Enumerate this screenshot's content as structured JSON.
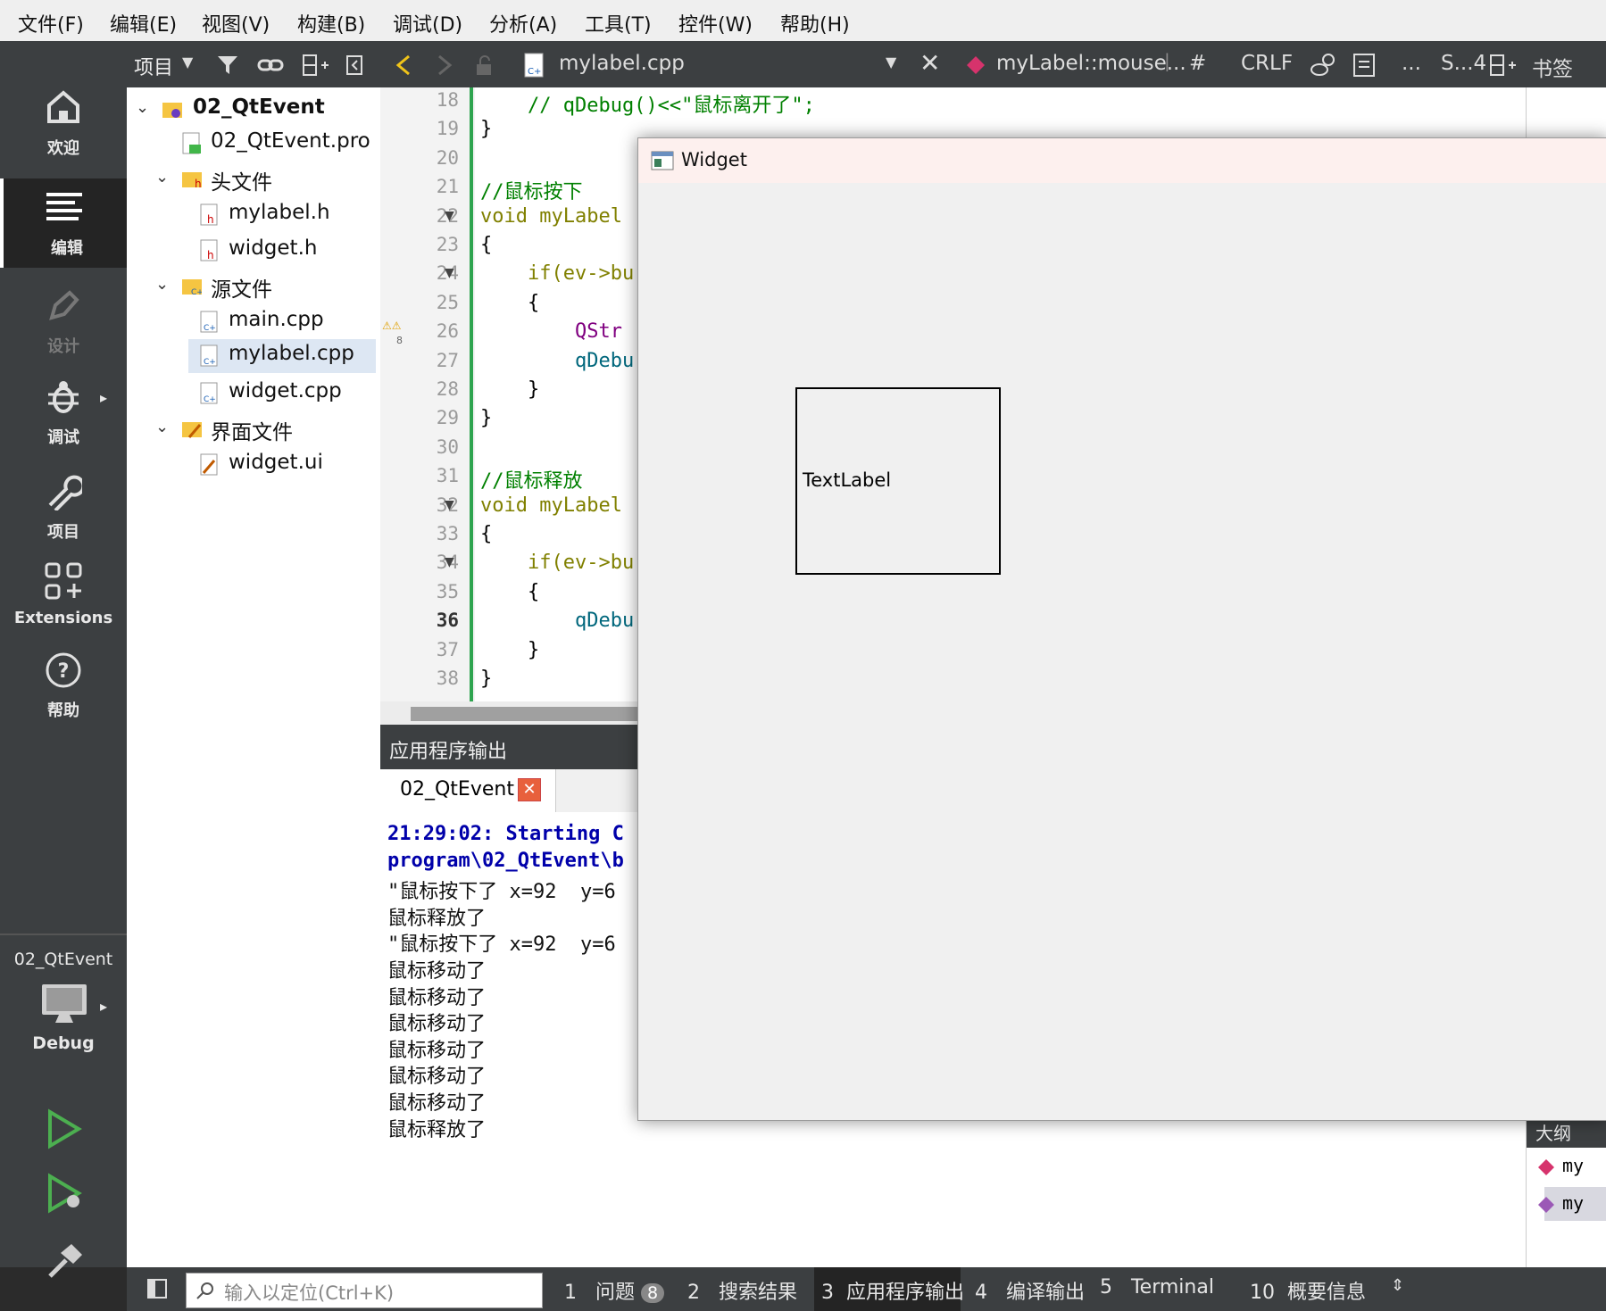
{
  "menu": [
    "文件(F)",
    "编辑(E)",
    "视图(V)",
    "构建(B)",
    "调试(D)",
    "分析(A)",
    "工具(T)",
    "控件(W)",
    "帮助(H)"
  ],
  "modes": [
    {
      "label": "欢迎",
      "icon": "home-icon"
    },
    {
      "label": "编辑",
      "icon": "edit-lines-icon"
    },
    {
      "label": "设计",
      "icon": "pen-icon"
    },
    {
      "label": "调试",
      "icon": "bug-icon"
    },
    {
      "label": "项目",
      "icon": "wrench-icon"
    },
    {
      "label": "Extensions",
      "icon": "extensions-icon"
    },
    {
      "label": "帮助",
      "icon": "help-icon"
    }
  ],
  "kit": {
    "project": "02_QtEvent",
    "config": "Debug"
  },
  "project_toolbar": {
    "label": "项目"
  },
  "tree": [
    {
      "label": "02_QtEvent",
      "level": 0,
      "bold": true,
      "expanded": true,
      "icon": "project-folder-icon"
    },
    {
      "label": "02_QtEvent.pro",
      "level": 1,
      "icon": "pro-file-icon"
    },
    {
      "label": "头文件",
      "level": 1,
      "expanded": true,
      "icon": "header-folder-icon"
    },
    {
      "label": "mylabel.h",
      "level": 2,
      "icon": "header-file-icon"
    },
    {
      "label": "widget.h",
      "level": 2,
      "icon": "header-file-icon"
    },
    {
      "label": "源文件",
      "level": 1,
      "expanded": true,
      "icon": "source-folder-icon"
    },
    {
      "label": "main.cpp",
      "level": 2,
      "icon": "cpp-file-icon"
    },
    {
      "label": "mylabel.cpp",
      "level": 2,
      "icon": "cpp-file-icon",
      "selected": true
    },
    {
      "label": "widget.cpp",
      "level": 2,
      "icon": "cpp-file-icon"
    },
    {
      "label": "界面文件",
      "level": 1,
      "expanded": true,
      "icon": "forms-folder-icon"
    },
    {
      "label": "widget.ui",
      "level": 2,
      "icon": "ui-file-icon"
    }
  ],
  "editor_toolbar": {
    "file": "mylabel.cpp",
    "symbol": "myLabel::mouse...",
    "hash": "#",
    "eol": "CRLF",
    "ellipsis": "...",
    "split": "S...4",
    "bookmarks": "书签"
  },
  "code_lines": [
    {
      "n": "18",
      "text": "    // qDebug()<<\"鼠标离开了\";",
      "kind": "comment"
    },
    {
      "n": "19",
      "text": "}"
    },
    {
      "n": "20",
      "text": ""
    },
    {
      "n": "21",
      "text": "//鼠标按下",
      "kind": "comment"
    },
    {
      "n": "22",
      "text": "void myLabel",
      "kind": "decl",
      "fold": true
    },
    {
      "n": "23",
      "text": "{"
    },
    {
      "n": "24",
      "text": "    if(ev->bu",
      "kind": "if",
      "fold": true
    },
    {
      "n": "25",
      "text": "    {"
    },
    {
      "n": "26",
      "text": "        QStr",
      "kind": "type",
      "warn": "8"
    },
    {
      "n": "27",
      "text": "        qDebu",
      "kind": "fn"
    },
    {
      "n": "28",
      "text": "    }"
    },
    {
      "n": "29",
      "text": "}"
    },
    {
      "n": "30",
      "text": ""
    },
    {
      "n": "31",
      "text": "//鼠标释放",
      "kind": "comment"
    },
    {
      "n": "32",
      "text": "void myLabel",
      "kind": "decl",
      "fold": true
    },
    {
      "n": "33",
      "text": "{"
    },
    {
      "n": "34",
      "text": "    if(ev->bu",
      "kind": "if",
      "fold": true
    },
    {
      "n": "35",
      "text": "    {"
    },
    {
      "n": "36",
      "text": "        qDebu",
      "kind": "fn",
      "current": true
    },
    {
      "n": "37",
      "text": "    }"
    },
    {
      "n": "38",
      "text": "}"
    }
  ],
  "output": {
    "header": "应用程序输出",
    "tab": "02_QtEvent",
    "lines": [
      {
        "text": "21:29:02: Starting C",
        "blue": true
      },
      {
        "text": "program\\02_QtEvent\\b",
        "blue": true
      },
      {
        "text": "\"鼠标按下了 x=92  y=6"
      },
      {
        "text": "鼠标释放了"
      },
      {
        "text": "\"鼠标按下了 x=92  y=6"
      },
      {
        "text": "鼠标移动了"
      },
      {
        "text": "鼠标移动了"
      },
      {
        "text": "鼠标移动了"
      },
      {
        "text": "鼠标移动了"
      },
      {
        "text": "鼠标移动了"
      },
      {
        "text": "鼠标移动了"
      },
      {
        "text": "鼠标释放了"
      }
    ]
  },
  "right_panel": {
    "title": "大纲",
    "items": [
      "my",
      "my"
    ]
  },
  "statusbar": {
    "locator_placeholder": "输入以定位(Ctrl+K)",
    "tabs": [
      {
        "num": "1",
        "label": "问题",
        "badge": "8"
      },
      {
        "num": "2",
        "label": "搜索结果"
      },
      {
        "num": "3",
        "label": "应用程序输出",
        "active": true
      },
      {
        "num": "4",
        "label": "编译输出"
      },
      {
        "num": "5",
        "label": "Terminal"
      },
      {
        "num": "10",
        "label": "概要信息"
      }
    ]
  },
  "widget": {
    "title": "Widget",
    "label": "TextLabel"
  }
}
